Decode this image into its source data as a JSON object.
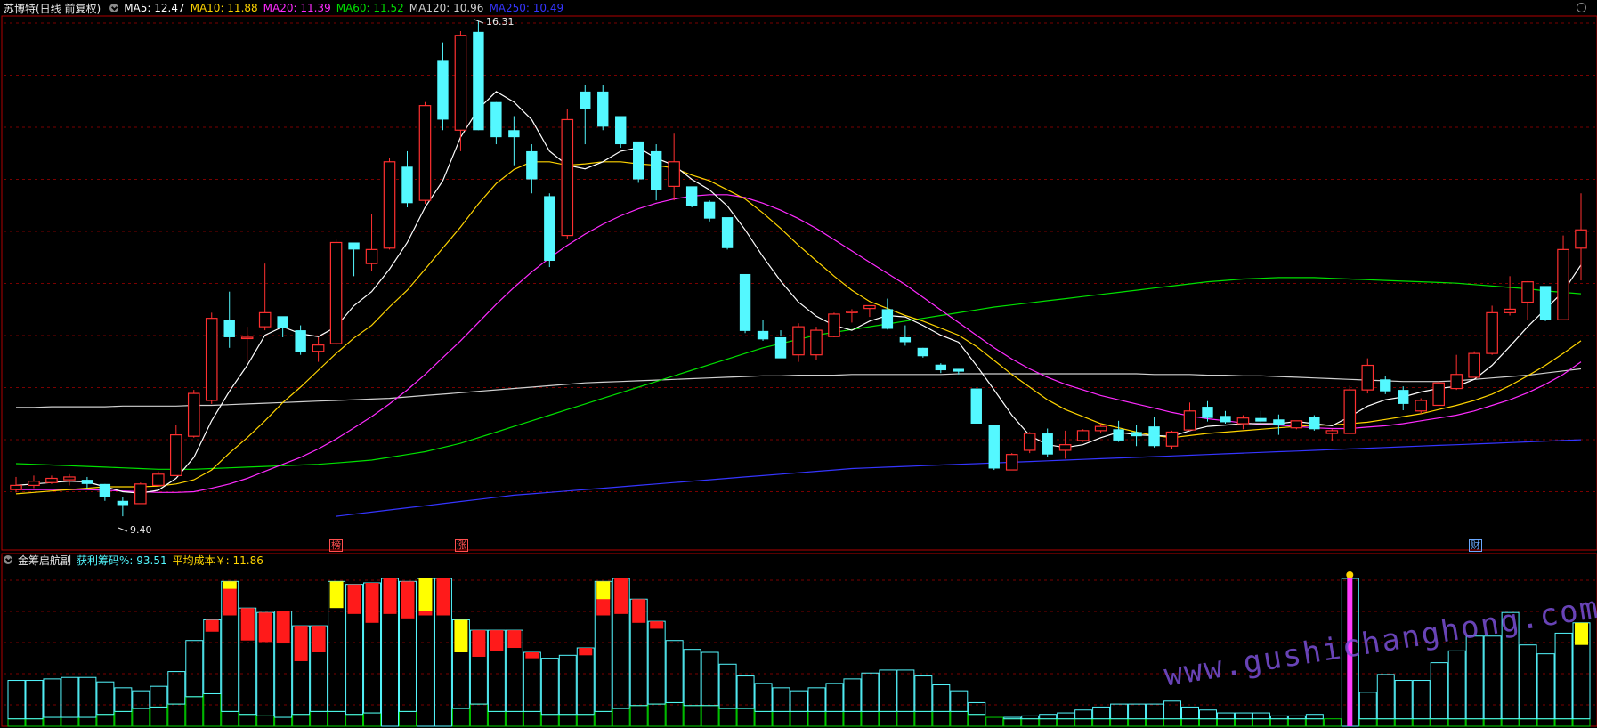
{
  "header": {
    "title": "苏博特(日线 前复权)",
    "ma": [
      {
        "label": "MA5: 12.47",
        "color": "#ffffff"
      },
      {
        "label": "MA10: 11.88",
        "color": "#ffd400"
      },
      {
        "label": "MA20: 11.39",
        "color": "#ff2bff"
      },
      {
        "label": "MA60: 11.52",
        "color": "#00e000"
      },
      {
        "label": "MA120: 10.96",
        "color": "#d0d0d0"
      },
      {
        "label": "MA250: 10.49",
        "color": "#3535ff"
      }
    ]
  },
  "annotations": {
    "high": "16.31",
    "low": "9.40"
  },
  "markers": {
    "bang": "榜",
    "zhang": "涨",
    "cai": "财"
  },
  "sub_header": {
    "title": "金筹启航副",
    "profit_label": "获利筹码%: 93.51",
    "cost_label": "平均成本￥: 11.86"
  },
  "watermark": "www.gushichanghong.com",
  "colors": {
    "up": "#ff3030",
    "down": "#54f8ff",
    "grid": "#7a0000",
    "frame": "#b00000"
  },
  "chart_data": {
    "type": "candlestick",
    "title": "苏博特(日线 前复权)",
    "ylim": [
      9.3,
      16.45
    ],
    "candles": [
      [
        9.78,
        9.96,
        9.74,
        9.84
      ],
      [
        9.84,
        9.98,
        9.8,
        9.9
      ],
      [
        9.88,
        9.98,
        9.86,
        9.94
      ],
      [
        9.92,
        10.0,
        9.84,
        9.96
      ],
      [
        9.92,
        9.96,
        9.8,
        9.86
      ],
      [
        9.86,
        9.86,
        9.62,
        9.68
      ],
      [
        9.62,
        9.68,
        9.4,
        9.56
      ],
      [
        9.58,
        9.88,
        9.58,
        9.86
      ],
      [
        9.84,
        10.04,
        9.82,
        10.0
      ],
      [
        9.98,
        10.7,
        9.98,
        10.56
      ],
      [
        10.54,
        11.2,
        10.52,
        11.15
      ],
      [
        11.05,
        12.3,
        11.0,
        12.22
      ],
      [
        12.2,
        12.6,
        11.8,
        11.95
      ],
      [
        11.95,
        12.1,
        11.6,
        11.95
      ],
      [
        12.1,
        13.0,
        12.05,
        12.3
      ],
      [
        12.25,
        12.2,
        11.95,
        12.08
      ],
      [
        12.05,
        12.12,
        11.7,
        11.74
      ],
      [
        11.75,
        11.95,
        11.6,
        11.84
      ],
      [
        11.86,
        13.35,
        11.84,
        13.3
      ],
      [
        13.3,
        13.2,
        12.82,
        13.2
      ],
      [
        13.0,
        13.7,
        12.9,
        13.2
      ],
      [
        13.22,
        14.5,
        13.2,
        14.45
      ],
      [
        14.38,
        14.6,
        13.8,
        13.86
      ],
      [
        13.9,
        15.3,
        13.85,
        15.25
      ],
      [
        15.9,
        16.15,
        14.9,
        15.05
      ],
      [
        14.9,
        16.31,
        14.6,
        16.25
      ],
      [
        16.3,
        16.45,
        14.9,
        14.9
      ],
      [
        15.3,
        15.3,
        14.7,
        14.8
      ],
      [
        14.9,
        15.1,
        14.4,
        14.8
      ],
      [
        14.6,
        14.7,
        14.0,
        14.2
      ],
      [
        13.96,
        14.0,
        12.95,
        13.04
      ],
      [
        13.4,
        15.2,
        13.35,
        15.05
      ],
      [
        15.45,
        15.55,
        14.7,
        15.2
      ],
      [
        15.45,
        15.55,
        14.9,
        14.95
      ],
      [
        15.1,
        15.0,
        14.65,
        14.7
      ],
      [
        14.74,
        14.7,
        14.15,
        14.2
      ],
      [
        14.6,
        14.7,
        13.9,
        14.05
      ],
      [
        14.1,
        14.85,
        13.9,
        14.45
      ],
      [
        14.1,
        14.05,
        13.8,
        13.82
      ],
      [
        13.88,
        13.9,
        13.6,
        13.64
      ],
      [
        13.66,
        13.6,
        13.2,
        13.22
      ],
      [
        12.85,
        12.8,
        12.01,
        12.04
      ],
      [
        12.04,
        12.2,
        11.9,
        11.92
      ],
      [
        11.95,
        12.05,
        11.96,
        11.65
      ],
      [
        11.7,
        12.15,
        11.6,
        12.1
      ],
      [
        11.7,
        12.1,
        11.62,
        12.05
      ],
      [
        11.96,
        12.3,
        11.95,
        12.28
      ],
      [
        12.32,
        12.35,
        12.16,
        12.32
      ],
      [
        12.36,
        12.4,
        12.24,
        12.4
      ],
      [
        12.35,
        12.5,
        12.06,
        12.07
      ],
      [
        11.95,
        12.12,
        11.83,
        11.88
      ],
      [
        11.8,
        11.8,
        11.66,
        11.68
      ],
      [
        11.56,
        11.58,
        11.44,
        11.48
      ],
      [
        11.5,
        11.5,
        11.42,
        11.46
      ],
      [
        11.22,
        11.2,
        10.74,
        10.72
      ],
      [
        10.7,
        10.66,
        10.06,
        10.08
      ],
      [
        10.06,
        10.3,
        10.2,
        10.28
      ],
      [
        10.34,
        10.6,
        10.3,
        10.58
      ],
      [
        10.58,
        10.65,
        10.25,
        10.28
      ],
      [
        10.34,
        10.62,
        10.22,
        10.42
      ],
      [
        10.48,
        10.64,
        10.46,
        10.62
      ],
      [
        10.62,
        10.72,
        10.58,
        10.68
      ],
      [
        10.64,
        10.76,
        10.46,
        10.48
      ],
      [
        10.6,
        10.7,
        10.4,
        10.54
      ],
      [
        10.68,
        10.82,
        10.38,
        10.4
      ],
      [
        10.4,
        10.62,
        10.36,
        10.6
      ],
      [
        10.63,
        11.02,
        10.62,
        10.9
      ],
      [
        10.96,
        11.04,
        10.75,
        10.8
      ],
      [
        10.83,
        10.9,
        10.72,
        10.74
      ],
      [
        10.72,
        10.84,
        10.64,
        10.8
      ],
      [
        10.8,
        10.9,
        10.72,
        10.75
      ],
      [
        10.78,
        10.85,
        10.56,
        10.7
      ],
      [
        10.66,
        10.76,
        10.64,
        10.76
      ],
      [
        10.82,
        10.84,
        10.62,
        10.64
      ],
      [
        10.58,
        10.64,
        10.48,
        10.62
      ],
      [
        10.58,
        11.26,
        10.58,
        11.2
      ],
      [
        11.2,
        11.65,
        11.15,
        11.55
      ],
      [
        11.35,
        11.4,
        11.14,
        11.18
      ],
      [
        11.2,
        11.25,
        10.91,
        11.0
      ],
      [
        10.9,
        11.08,
        10.86,
        11.05
      ],
      [
        10.98,
        11.32,
        10.98,
        11.3
      ],
      [
        11.22,
        11.7,
        11.2,
        11.42
      ],
      [
        11.38,
        11.75,
        11.4,
        11.72
      ],
      [
        11.72,
        12.4,
        11.7,
        12.3
      ],
      [
        12.3,
        12.82,
        12.26,
        12.35
      ],
      [
        12.45,
        12.75,
        12.2,
        12.74
      ],
      [
        12.68,
        12.6,
        12.18,
        12.2
      ],
      [
        12.2,
        13.4,
        12.25,
        13.2
      ],
      [
        13.22,
        14.0,
        12.76,
        13.48
      ]
    ],
    "ma5": [
      9.84,
      9.86,
      9.88,
      9.9,
      9.89,
      9.82,
      9.75,
      9.73,
      9.77,
      9.94,
      10.24,
      10.76,
      11.18,
      11.55,
      11.98,
      12.1,
      12.0,
      11.96,
      12.1,
      12.4,
      12.6,
      12.92,
      13.3,
      13.8,
      14.18,
      14.8,
      15.2,
      15.45,
      15.3,
      15.05,
      14.6,
      14.4,
      14.35,
      14.45,
      14.6,
      14.65,
      14.5,
      14.4,
      14.2,
      14.05,
      13.82,
      13.48,
      13.1,
      12.75,
      12.45,
      12.25,
      12.12,
      12.05,
      12.18,
      12.26,
      12.24,
      12.12,
      11.98,
      11.88,
      11.55,
      11.2,
      10.84,
      10.55,
      10.42,
      10.38,
      10.42,
      10.52,
      10.6,
      10.56,
      10.55,
      10.54,
      10.62,
      10.68,
      10.7,
      10.72,
      10.72,
      10.72,
      10.75,
      10.72,
      10.69,
      10.82,
      10.97,
      11.06,
      11.1,
      11.17,
      11.22,
      11.25,
      11.35,
      11.55,
      11.82,
      12.1,
      12.35,
      12.6,
      12.98
    ],
    "ma10": [
      9.72,
      9.74,
      9.76,
      9.78,
      9.8,
      9.82,
      9.82,
      9.82,
      9.83,
      9.86,
      9.92,
      10.06,
      10.3,
      10.52,
      10.76,
      11.02,
      11.24,
      11.48,
      11.72,
      11.94,
      12.12,
      12.38,
      12.62,
      12.92,
      13.22,
      13.52,
      13.85,
      14.14,
      14.34,
      14.45,
      14.45,
      14.4,
      14.42,
      14.45,
      14.45,
      14.42,
      14.4,
      14.36,
      14.26,
      14.18,
      14.05,
      13.92,
      13.72,
      13.5,
      13.26,
      13.04,
      12.82,
      12.62,
      12.46,
      12.36,
      12.26,
      12.18,
      12.08,
      11.98,
      11.82,
      11.62,
      11.42,
      11.24,
      11.06,
      10.92,
      10.82,
      10.72,
      10.66,
      10.6,
      10.55,
      10.52,
      10.55,
      10.58,
      10.6,
      10.62,
      10.64,
      10.66,
      10.68,
      10.7,
      10.7,
      10.72,
      10.74,
      10.78,
      10.82,
      10.86,
      10.92,
      10.98,
      11.05,
      11.14,
      11.26,
      11.4,
      11.55,
      11.72,
      11.9
    ],
    "ma20": [
      9.78,
      9.78,
      9.78,
      9.78,
      9.78,
      9.77,
      9.76,
      9.75,
      9.74,
      9.74,
      9.75,
      9.8,
      9.86,
      9.94,
      10.04,
      10.14,
      10.24,
      10.36,
      10.5,
      10.66,
      10.82,
      11.0,
      11.2,
      11.42,
      11.66,
      11.9,
      12.16,
      12.42,
      12.66,
      12.88,
      13.08,
      13.26,
      13.42,
      13.56,
      13.68,
      13.78,
      13.86,
      13.92,
      13.96,
      13.98,
      13.98,
      13.94,
      13.86,
      13.76,
      13.64,
      13.5,
      13.34,
      13.18,
      13.02,
      12.86,
      12.7,
      12.52,
      12.34,
      12.16,
      11.98,
      11.8,
      11.64,
      11.5,
      11.38,
      11.28,
      11.2,
      11.12,
      11.06,
      11.0,
      10.94,
      10.88,
      10.83,
      10.79,
      10.76,
      10.73,
      10.71,
      10.7,
      10.68,
      10.66,
      10.65,
      10.65,
      10.67,
      10.69,
      10.72,
      10.76,
      10.8,
      10.84,
      10.9,
      10.98,
      11.06,
      11.16,
      11.28,
      11.42,
      11.6
    ],
    "ma60": [
      10.15,
      10.14,
      10.13,
      10.12,
      10.11,
      10.1,
      10.09,
      10.08,
      10.07,
      10.07,
      10.07,
      10.08,
      10.09,
      10.1,
      10.11,
      10.12,
      10.13,
      10.14,
      10.16,
      10.18,
      10.2,
      10.24,
      10.28,
      10.32,
      10.38,
      10.44,
      10.52,
      10.6,
      10.68,
      10.76,
      10.84,
      10.92,
      11.0,
      11.08,
      11.16,
      11.24,
      11.32,
      11.4,
      11.48,
      11.56,
      11.64,
      11.72,
      11.8,
      11.86,
      11.92,
      11.98,
      12.02,
      12.06,
      12.1,
      12.14,
      12.18,
      12.22,
      12.26,
      12.3,
      12.34,
      12.38,
      12.41,
      12.44,
      12.47,
      12.5,
      12.53,
      12.56,
      12.59,
      12.62,
      12.65,
      12.68,
      12.71,
      12.74,
      12.76,
      12.78,
      12.79,
      12.8,
      12.8,
      12.8,
      12.79,
      12.78,
      12.77,
      12.76,
      12.75,
      12.74,
      12.73,
      12.72,
      12.7,
      12.68,
      12.66,
      12.64,
      12.61,
      12.59,
      12.57
    ],
    "ma120": [
      10.95,
      10.95,
      10.96,
      10.96,
      10.96,
      10.96,
      10.97,
      10.97,
      10.97,
      10.97,
      10.98,
      10.98,
      10.99,
      11.0,
      11.01,
      11.02,
      11.03,
      11.04,
      11.05,
      11.06,
      11.07,
      11.08,
      11.1,
      11.12,
      11.14,
      11.16,
      11.18,
      11.2,
      11.22,
      11.24,
      11.26,
      11.28,
      11.3,
      11.31,
      11.32,
      11.33,
      11.34,
      11.35,
      11.36,
      11.37,
      11.38,
      11.39,
      11.4,
      11.4,
      11.41,
      11.41,
      11.41,
      11.42,
      11.42,
      11.42,
      11.42,
      11.42,
      11.42,
      11.43,
      11.43,
      11.43,
      11.43,
      11.43,
      11.43,
      11.43,
      11.43,
      11.43,
      11.43,
      11.43,
      11.42,
      11.42,
      11.42,
      11.41,
      11.41,
      11.4,
      11.4,
      11.39,
      11.38,
      11.37,
      11.36,
      11.35,
      11.34,
      11.33,
      11.32,
      11.32,
      11.32,
      11.33,
      11.35,
      11.37,
      11.39,
      11.41,
      11.44,
      11.47,
      11.5
    ],
    "ma250": [
      null,
      null,
      null,
      null,
      null,
      null,
      null,
      null,
      null,
      null,
      null,
      null,
      null,
      null,
      null,
      null,
      null,
      null,
      9.4,
      9.43,
      9.46,
      9.49,
      9.52,
      9.55,
      9.58,
      9.61,
      9.64,
      9.67,
      9.7,
      9.72,
      9.74,
      9.76,
      9.78,
      9.8,
      9.82,
      9.84,
      9.86,
      9.88,
      9.9,
      9.92,
      9.94,
      9.96,
      9.98,
      10.0,
      10.02,
      10.04,
      10.06,
      10.08,
      10.09,
      10.1,
      10.11,
      10.12,
      10.13,
      10.14,
      10.15,
      10.16,
      10.17,
      10.18,
      10.19,
      10.2,
      10.21,
      10.22,
      10.23,
      10.24,
      10.25,
      10.26,
      10.27,
      10.28,
      10.29,
      10.3,
      10.31,
      10.32,
      10.33,
      10.34,
      10.35,
      10.36,
      10.37,
      10.38,
      10.39,
      10.4,
      10.41,
      10.42,
      10.43,
      10.44,
      10.45,
      10.46,
      10.47,
      10.48,
      10.49
    ],
    "chips": {
      "ylim": [
        0,
        100
      ],
      "profit": [
        26,
        26,
        26,
        27,
        27,
        22,
        16,
        12,
        14,
        22,
        38,
        50,
        88,
        72,
        70,
        72,
        60,
        58,
        88,
        88,
        88,
        100,
        88,
        100,
        100,
        60,
        50,
        55,
        55,
        40,
        38,
        40,
        45,
        88,
        88,
        72,
        56,
        42,
        38,
        36,
        30,
        22,
        19,
        16,
        14,
        16,
        19,
        22,
        26,
        28,
        28,
        24,
        18,
        14,
        8,
        0,
        1,
        2,
        3,
        4,
        6,
        8,
        10,
        10,
        10,
        12,
        8,
        6,
        4,
        4,
        4,
        2,
        2,
        3,
        0,
        100,
        18,
        30,
        26,
        26,
        38,
        46,
        56,
        56,
        72,
        50,
        44,
        58,
        65
      ],
      "trapped": [
        5,
        5,
        6,
        6,
        6,
        8,
        10,
        12,
        13,
        15,
        20,
        22,
        10,
        8,
        7,
        6,
        8,
        10,
        10,
        8,
        9,
        0,
        10,
        0,
        0,
        12,
        15,
        10,
        10,
        10,
        8,
        8,
        8,
        10,
        12,
        14,
        15,
        16,
        14,
        14,
        12,
        12,
        10,
        10,
        10,
        10,
        10,
        10,
        10,
        10,
        10,
        10,
        10,
        10,
        8,
        6,
        5,
        5,
        5,
        5,
        5,
        5,
        5,
        5,
        5,
        5,
        5,
        5,
        5,
        5,
        5,
        5,
        5,
        5,
        5,
        0,
        5,
        5,
        5,
        5,
        5,
        5,
        5,
        5,
        5,
        5,
        5,
        5,
        5
      ],
      "red_band": [
        0,
        0,
        0,
        0,
        0,
        0,
        0,
        0,
        0,
        0,
        0,
        8,
        23,
        22,
        20,
        22,
        24,
        18,
        0,
        20,
        27,
        24,
        25,
        25,
        25,
        20,
        18,
        14,
        12,
        4,
        0,
        0,
        5,
        23,
        24,
        16,
        5,
        0,
        0,
        0,
        0,
        0,
        0,
        0,
        0,
        0,
        0,
        0,
        0,
        0,
        0,
        0,
        0,
        0,
        0,
        0,
        0,
        0,
        0,
        0,
        0,
        0,
        0,
        0,
        0,
        0,
        0,
        0,
        0,
        0,
        0,
        0,
        0,
        0,
        0,
        0,
        0,
        0,
        0,
        0,
        0,
        0,
        0,
        0,
        0,
        0,
        0,
        0,
        0
      ],
      "yellow_top": [
        0,
        0,
        0,
        0,
        0,
        0,
        0,
        0,
        0,
        0,
        0,
        0,
        5,
        0,
        0,
        0,
        0,
        0,
        18,
        0,
        0,
        0,
        0,
        22,
        0,
        22,
        0,
        0,
        0,
        0,
        0,
        0,
        0,
        12,
        0,
        0,
        0,
        0,
        0,
        0,
        0,
        0,
        0,
        0,
        0,
        0,
        0,
        0,
        0,
        0,
        0,
        0,
        0,
        0,
        0,
        0,
        0,
        0,
        0,
        0,
        0,
        0,
        0,
        0,
        0,
        0,
        0,
        0,
        0,
        0,
        0,
        0,
        0,
        0,
        0,
        0,
        0,
        0,
        0,
        0,
        0,
        0,
        0,
        0,
        0,
        0,
        0,
        0,
        15
      ]
    }
  }
}
